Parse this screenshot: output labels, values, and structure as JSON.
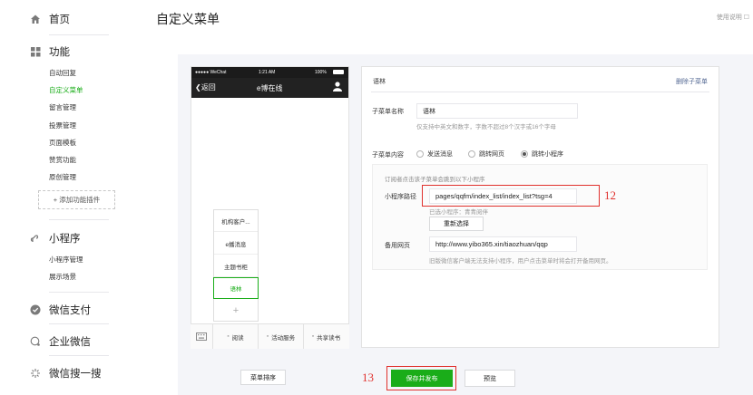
{
  "sidebar": {
    "home": "首页",
    "features": "功能",
    "feature_items": [
      "自动回复",
      "自定义菜单",
      "留言管理",
      "投票管理",
      "页面模板",
      "赞赏功能",
      "原创管理"
    ],
    "add_plugin": "+ 添加功能插件",
    "miniprogram": "小程序",
    "miniprogram_items": [
      "小程序管理",
      "展示场景"
    ],
    "wechat_pay": "微信支付",
    "enterprise_wechat": "企业微信",
    "wechat_search": "微信搜一搜"
  },
  "header": {
    "title": "自定义菜单",
    "help": "使用说明"
  },
  "phone": {
    "carrier": "●●●●● WeChat",
    "time": "1:21 AM",
    "battery": "100%",
    "back": "返回",
    "title": "e博在线",
    "submenu": [
      "机构客户...",
      "e播消息",
      "主题书柜",
      "语林",
      "+"
    ],
    "tabs": [
      "阅读",
      "活动服务",
      "共享读书"
    ]
  },
  "editor": {
    "name_header": "语林",
    "delete_sub": "删除子菜单",
    "name_label": "子菜单名称",
    "name_value": "语林",
    "name_hint": "仅支持中英文和数字，字数不超过8个汉字或16个字母",
    "content_label": "子菜单内容",
    "options": [
      "发送消息",
      "跳转网页",
      "跳转小程序"
    ],
    "selected_option": "跳转小程序",
    "mp_desc": "订阅者点击该子菜单会跳到以下小程序",
    "path_label": "小程序路径",
    "path_value": "pages/qqfm/index_list/index_list?tsg=4",
    "selected_mp": "已选小程序：青青阅伴",
    "reselect": "重新选择",
    "backup_label": "备用网页",
    "backup_value": "http://www.yibo365.xin/tiaozhuan/qqp",
    "backup_hint": "旧版微信客户端无法支持小程序，用户点击菜单时将会打开备用网页。"
  },
  "footer": {
    "sort": "菜单排序",
    "save_publish": "保存并发布",
    "preview": "预览"
  },
  "annotations": {
    "a12": "12",
    "a13": "13"
  },
  "colors": {
    "accent": "#1aad19",
    "annotation": "#e0312d"
  }
}
